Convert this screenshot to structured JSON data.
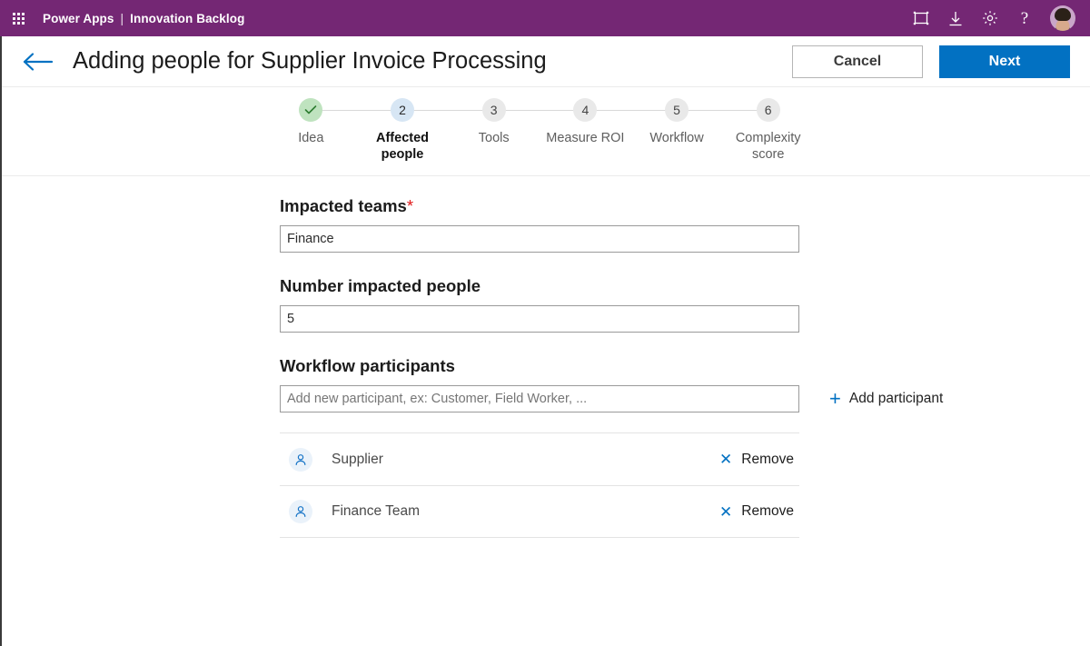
{
  "suite": {
    "waffle_icon": "app-launcher-grid-icon",
    "brand": "Power Apps",
    "separator": "|",
    "app_name": "Innovation Backlog",
    "icons": [
      {
        "name": "fit-to-screen-icon",
        "glyph": "fit-screen"
      },
      {
        "name": "download-icon",
        "glyph": "download"
      },
      {
        "name": "settings-gear-icon",
        "glyph": "gear"
      },
      {
        "name": "help-icon",
        "glyph": "?"
      }
    ],
    "avatar_alt": "user-avatar"
  },
  "header": {
    "back_icon": "back-arrow-icon",
    "title": "Adding people for Supplier Invoice Processing",
    "cancel_label": "Cancel",
    "next_label": "Next"
  },
  "stepper": {
    "current_step": 2,
    "steps": [
      {
        "number": "1",
        "label": "Idea",
        "state": "done",
        "marker": "✓"
      },
      {
        "number": "2",
        "label": "Affected people",
        "state": "active",
        "marker": "2"
      },
      {
        "number": "3",
        "label": "Tools",
        "state": "todo",
        "marker": "3"
      },
      {
        "number": "4",
        "label": "Measure ROI",
        "state": "todo",
        "marker": "4"
      },
      {
        "number": "5",
        "label": "Workflow",
        "state": "todo",
        "marker": "5"
      },
      {
        "number": "6",
        "label": "Complexity score",
        "state": "todo",
        "marker": "6"
      }
    ]
  },
  "form": {
    "impacted_teams": {
      "label": "Impacted teams",
      "required_marker": "*",
      "value": "Finance",
      "placeholder": ""
    },
    "number_impacted_people": {
      "label": "Number impacted people",
      "value": "5",
      "placeholder": ""
    },
    "workflow_participants": {
      "label": "Workflow participants",
      "input_value": "",
      "placeholder": "Add new participant, ex: Customer, Field Worker, ...",
      "add_label": "Add participant",
      "add_icon": "plus-icon",
      "items": [
        {
          "icon": "person-icon",
          "name": "Supplier",
          "remove_label": "Remove",
          "remove_icon": "close-x-icon"
        },
        {
          "icon": "person-icon",
          "name": "Finance Team",
          "remove_label": "Remove",
          "remove_icon": "close-x-icon"
        }
      ]
    }
  },
  "colors": {
    "suite_purple": "#742774",
    "primary_blue": "#0271c2",
    "done_green": "#bfe3bf",
    "active_step_blue": "#d7e6f4",
    "required_red": "#e01b1b"
  }
}
